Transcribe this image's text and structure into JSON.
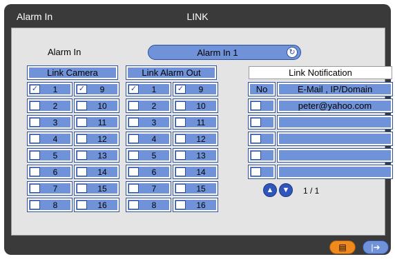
{
  "title": {
    "left": "Alarm In",
    "center": "LINK"
  },
  "alarm_in": {
    "label": "Alarm In",
    "value": "Alarm In 1",
    "refresh_icon": "refresh-icon"
  },
  "link_camera": {
    "header": "Link Camera",
    "items": [
      {
        "label": "1",
        "checked": true
      },
      {
        "label": "9",
        "checked": true
      },
      {
        "label": "2",
        "checked": false
      },
      {
        "label": "10",
        "checked": false
      },
      {
        "label": "3",
        "checked": false
      },
      {
        "label": "11",
        "checked": false
      },
      {
        "label": "4",
        "checked": false
      },
      {
        "label": "12",
        "checked": false
      },
      {
        "label": "5",
        "checked": false
      },
      {
        "label": "13",
        "checked": false
      },
      {
        "label": "6",
        "checked": false
      },
      {
        "label": "14",
        "checked": false
      },
      {
        "label": "7",
        "checked": false
      },
      {
        "label": "15",
        "checked": false
      },
      {
        "label": "8",
        "checked": false
      },
      {
        "label": "16",
        "checked": false
      }
    ]
  },
  "link_alarm_out": {
    "header": "Link Alarm Out",
    "items": [
      {
        "label": "1",
        "checked": true
      },
      {
        "label": "9",
        "checked": true
      },
      {
        "label": "2",
        "checked": false
      },
      {
        "label": "10",
        "checked": false
      },
      {
        "label": "3",
        "checked": false
      },
      {
        "label": "11",
        "checked": false
      },
      {
        "label": "4",
        "checked": false
      },
      {
        "label": "12",
        "checked": false
      },
      {
        "label": "5",
        "checked": false
      },
      {
        "label": "13",
        "checked": false
      },
      {
        "label": "6",
        "checked": false
      },
      {
        "label": "14",
        "checked": false
      },
      {
        "label": "7",
        "checked": false
      },
      {
        "label": "15",
        "checked": false
      },
      {
        "label": "8",
        "checked": false
      },
      {
        "label": "16",
        "checked": false
      }
    ]
  },
  "link_notification": {
    "header": "Link Notification",
    "col_no": "No",
    "col_addr": "E-Mail , IP/Domain",
    "rows": [
      {
        "checked": false,
        "address": "peter@yahoo.com"
      },
      {
        "checked": false,
        "address": ""
      },
      {
        "checked": false,
        "address": ""
      },
      {
        "checked": false,
        "address": ""
      },
      {
        "checked": false,
        "address": ""
      }
    ],
    "pagination": "1 / 1"
  },
  "footer": {
    "save_icon": "save-icon",
    "exit_icon": "exit-icon"
  },
  "colors": {
    "frame": "#3a3a3a",
    "panel": "#e4e4e4",
    "cell": "#6f92d8",
    "accent_orange": "#f08a1c"
  }
}
